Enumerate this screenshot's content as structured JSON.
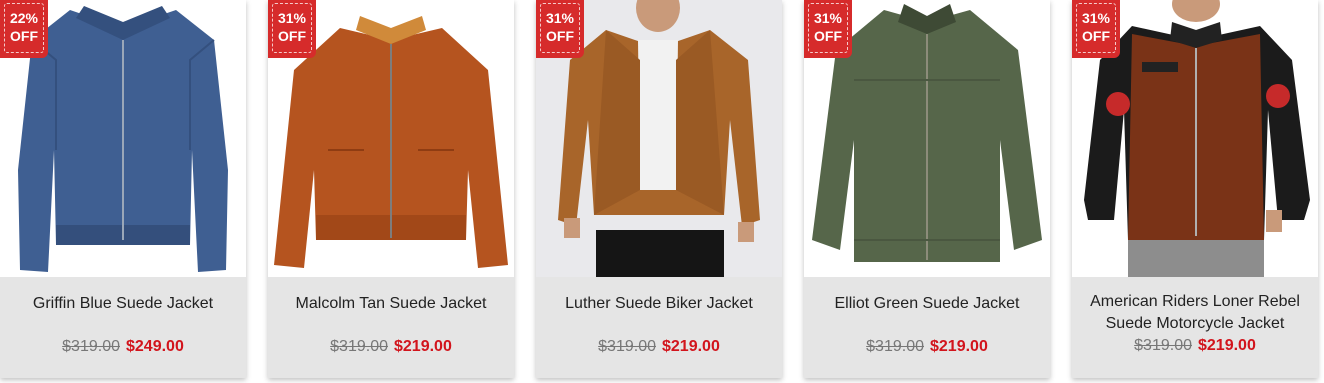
{
  "products": [
    {
      "name": "Griffin Blue Suede Jacket",
      "discount_line1": "22%",
      "discount_line2": "OFF",
      "old_price": "$319.00",
      "new_price": "$249.00",
      "jacket_color": "#3f5f92"
    },
    {
      "name": "Malcolm Tan Suede Jacket",
      "discount_line1": "31%",
      "discount_line2": "OFF",
      "old_price": "$319.00",
      "new_price": "$219.00",
      "jacket_color": "#b5541f"
    },
    {
      "name": "Luther Suede Biker Jacket",
      "discount_line1": "31%",
      "discount_line2": "OFF",
      "old_price": "$319.00",
      "new_price": "$219.00",
      "jacket_color": "#a8652a"
    },
    {
      "name": "Elliot Green Suede Jacket",
      "discount_line1": "31%",
      "discount_line2": "OFF",
      "old_price": "$319.00",
      "new_price": "$219.00",
      "jacket_color": "#56664a"
    },
    {
      "name": "American Riders Loner Rebel Suede Motorcycle Jacket",
      "discount_line1": "31%",
      "discount_line2": "OFF",
      "old_price": "$319.00",
      "new_price": "$219.00",
      "jacket_color": "#7a3317"
    }
  ],
  "colors": {
    "badge_bg": "#d62b2b",
    "sale_price": "#d2141c",
    "info_bg": "#e5e5e5"
  }
}
